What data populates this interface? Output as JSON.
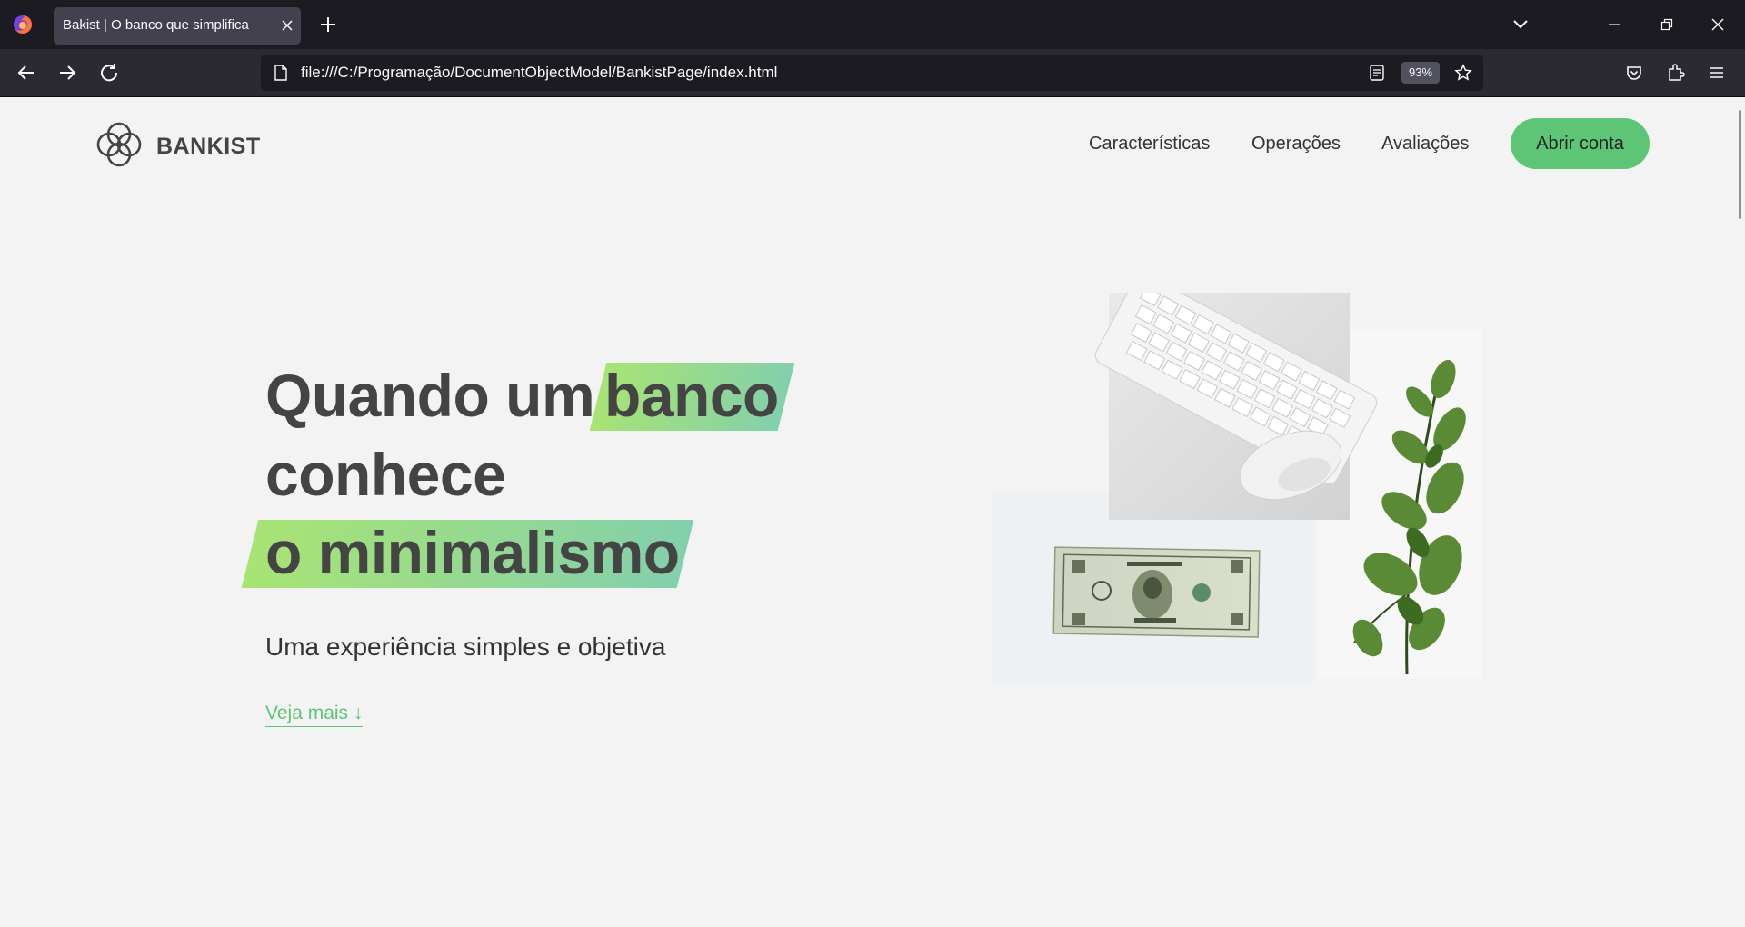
{
  "browser": {
    "tab_title": "Bakist | O banco que simplifica",
    "url": "file:///C:/Programação/DocumentObjectModel/BankistPage/index.html",
    "zoom": "93%",
    "icons": [
      "firefox-icon",
      "close-icon",
      "plus-icon",
      "chevron-down-icon",
      "minimize-icon",
      "restore-icon",
      "close-window-icon",
      "back-icon",
      "forward-icon",
      "reload-icon",
      "page-icon",
      "reader-view-icon",
      "star-icon",
      "pocket-icon",
      "extensions-icon",
      "menu-icon"
    ]
  },
  "site": {
    "logo_text": "BANKIST",
    "nav": [
      "Características",
      "Operações",
      "Avaliações"
    ],
    "cta": "Abrir conta"
  },
  "hero": {
    "line1_a": "Quando um",
    "line1_b": "banco",
    "line2": "conhece",
    "line3": "o minimalismo",
    "subtitle": "Uma experiência simples e objetiva",
    "link": "Veja mais ↓"
  },
  "colors": {
    "accent": "#5ec576",
    "highlight_start": "#9be15d",
    "highlight_end": "#6fc9a0",
    "page_bg": "#f3f3f3",
    "chrome_dark": "#1c1b22",
    "chrome_toolbar": "#2b2a33"
  }
}
